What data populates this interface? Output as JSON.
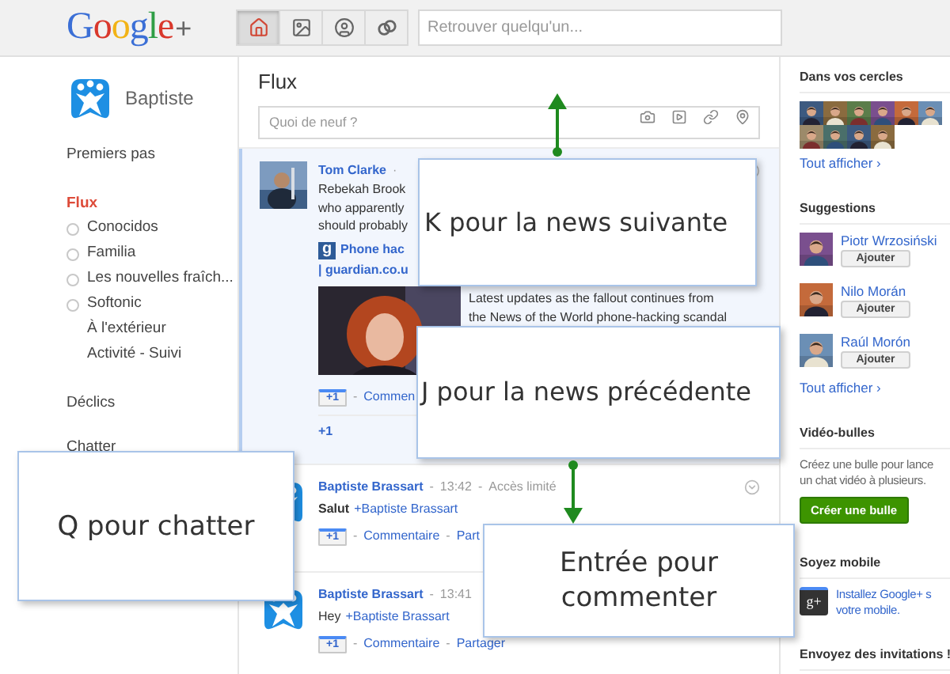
{
  "header": {
    "logo": "Google",
    "logo_plus": "+",
    "nav": [
      {
        "kind": "home",
        "selected": true
      },
      {
        "kind": "photos",
        "selected": false
      },
      {
        "kind": "profile",
        "selected": false
      },
      {
        "kind": "circles",
        "selected": false
      }
    ],
    "search": {
      "placeholder": "Retrouver quelqu'un..."
    }
  },
  "sidebar": {
    "profile": {
      "name": "Baptiste"
    },
    "first_steps": "Premiers pas",
    "stream": {
      "label": "Flux",
      "selected": true
    },
    "circles": [
      {
        "label": "Conocidos",
        "kind": "circle"
      },
      {
        "label": "Familia",
        "kind": "circle"
      },
      {
        "label": "Les nouvelles fraîch...",
        "kind": "circle"
      },
      {
        "label": "Softonic",
        "kind": "circle"
      },
      {
        "label": "À l'extérieur",
        "kind": "plain"
      },
      {
        "label": "Activité - Suivi",
        "kind": "plain"
      }
    ],
    "sparks": "Déclics",
    "chat": {
      "title": "Chatter"
    }
  },
  "stream": {
    "title": "Flux",
    "compose": {
      "placeholder": "Quoi de neuf ?"
    },
    "posts": [
      {
        "author": "Tom Clarke",
        "avatar": {
          "kind": "picture"
        },
        "meta": [
          "·"
        ],
        "menu": true,
        "selected": true,
        "lines": [
          "Rebekah Brook",
          "who apparently",
          "should probably"
        ],
        "link": {
          "icon": "g",
          "lines": [
            "Phone hac",
            "| guardian.co.u"
          ],
          "snippet_lines": [
            "Latest updates as the fallout continues from",
            "the News of the World phone-hacking scandal"
          ]
        },
        "actions": [
          {
            "kind": "plusone",
            "label": "+1"
          },
          {
            "kind": "sep",
            "label": "-"
          },
          {
            "kind": "link",
            "label": "Commen"
          }
        ],
        "plus_summary": "+1"
      },
      {
        "author": "Baptiste Brassart",
        "avatar": {
          "kind": "logo"
        },
        "meta": [
          "-",
          "13:42",
          "-",
          "Accès limité"
        ],
        "menu": true,
        "selected": false,
        "message": "Salut",
        "bold": true,
        "mention": "+Baptiste Brassart",
        "actions": [
          {
            "kind": "plusone",
            "label": "+1"
          },
          {
            "kind": "sep",
            "label": "-"
          },
          {
            "kind": "link",
            "label": "Commentaire"
          },
          {
            "kind": "sep",
            "label": "-"
          },
          {
            "kind": "link",
            "label": "Part"
          }
        ]
      },
      {
        "author": "Baptiste Brassart",
        "avatar": {
          "kind": "logo"
        },
        "meta": [
          "-",
          "13:41"
        ],
        "selected": false,
        "message": "Hey",
        "bold": false,
        "mention": "+Baptiste Brassart",
        "actions": [
          {
            "kind": "plusone",
            "label": "+1"
          },
          {
            "kind": "sep",
            "label": "-"
          },
          {
            "kind": "link",
            "label": "Commentaire"
          },
          {
            "kind": "sep",
            "label": "-"
          },
          {
            "kind": "link",
            "label": "Partager"
          }
        ]
      }
    ]
  },
  "right": {
    "circles": {
      "title": "Dans vos cercles",
      "people": [
        {
          "kind": "picture"
        },
        {
          "kind": "picture"
        },
        {
          "kind": "picture"
        },
        {
          "kind": "picture"
        },
        {
          "kind": "picture"
        },
        {
          "kind": "picture"
        },
        {
          "kind": "picture"
        },
        {
          "kind": "picture"
        },
        {
          "kind": "picture"
        },
        {
          "kind": "picture"
        }
      ],
      "more": "Tout afficher ›"
    },
    "suggestions": {
      "title": "Suggestions",
      "people": [
        {
          "name": "Piotr Wrzosiński",
          "button": "Ajouter"
        },
        {
          "name": "Nilo Morán",
          "button": "Ajouter"
        },
        {
          "name": "Raúl Morón",
          "button": "Ajouter"
        }
      ],
      "more": "Tout afficher ›"
    },
    "hangouts": {
      "title": "Vidéo-bulles",
      "lines": [
        "Créez une bulle pour lance",
        "un chat vidéo à plusieurs."
      ],
      "button": "Créer une bulle"
    },
    "mobile": {
      "title": "Soyez mobile",
      "icon": "g+",
      "lines": [
        "Installez Google+ s",
        "votre mobile."
      ]
    },
    "invites": {
      "title": "Envoyez des invitations !"
    }
  },
  "hints": [
    {
      "text": "K pour la news suivante"
    },
    {
      "text": "J pour la news précédente"
    },
    {
      "text": "Q pour chatter"
    },
    {
      "text": "Entrée pour commenter"
    }
  ],
  "arrows": [
    {
      "kind": "up"
    },
    {
      "kind": "down"
    }
  ]
}
